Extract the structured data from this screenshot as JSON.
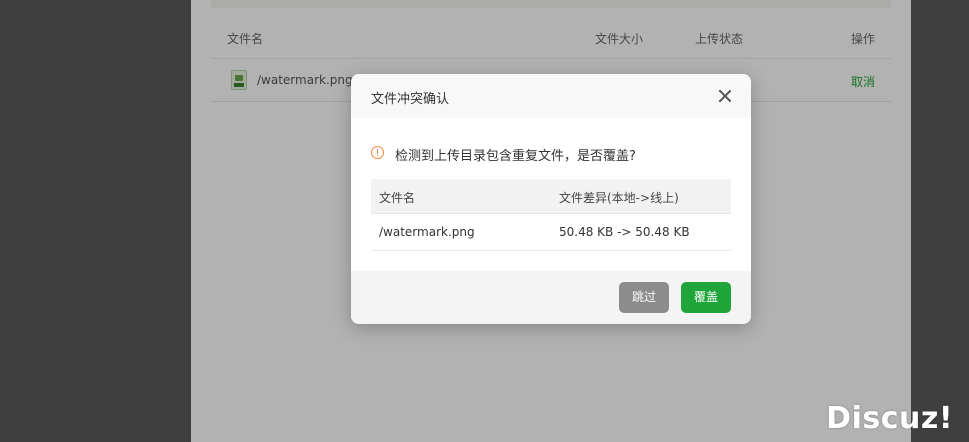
{
  "background": {
    "table_headers": {
      "name": "文件名",
      "size": "文件大小",
      "status": "上传状态",
      "action": "操作"
    },
    "file_row": {
      "name": "/watermark.png",
      "action": "取消"
    }
  },
  "dialog": {
    "title": "文件冲突确认",
    "message": "检测到上传目录包含重复文件，是否覆盖?",
    "table": {
      "headers": [
        "文件名",
        "文件差异(本地->线上)"
      ],
      "rows": [
        [
          "/watermark.png",
          "50.48 KB -> 50.48 KB"
        ]
      ]
    },
    "buttons": {
      "skip": "跳过",
      "cover": "覆盖"
    }
  },
  "watermark": "Discuz!",
  "colors": {
    "accent_green": "#20a53a",
    "warning_orange": "#f0883a",
    "skip_gray": "#8c8c8c"
  }
}
